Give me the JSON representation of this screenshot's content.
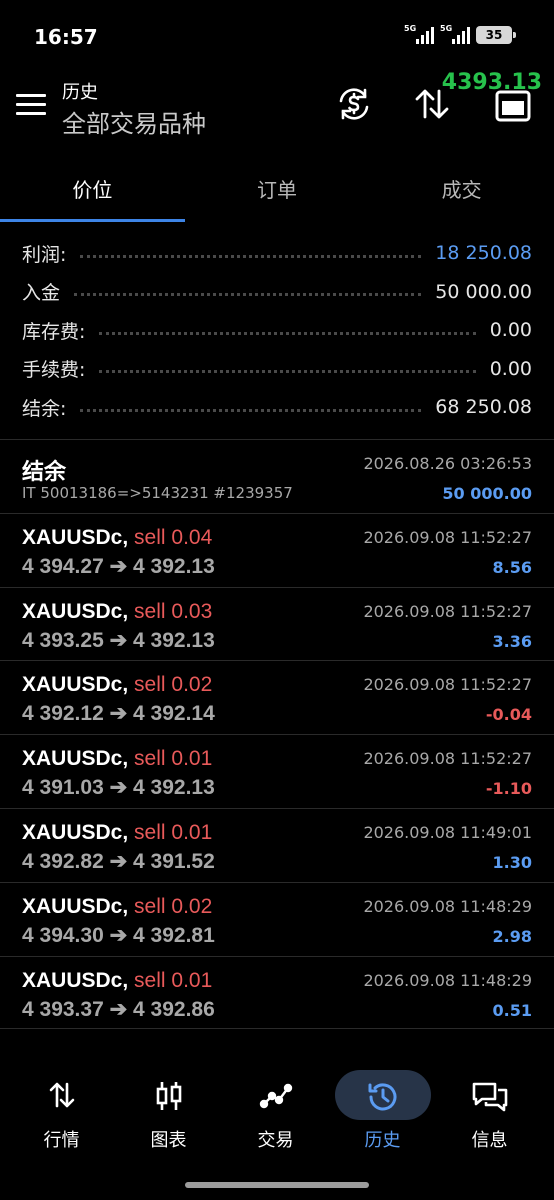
{
  "status": {
    "time": "16:57",
    "sim1": "5G",
    "sim2": "5G",
    "battery": "35"
  },
  "header": {
    "title": "历史",
    "subtitle": "全部交易品种",
    "floating_price": "4393.13",
    "icons": [
      "menu-icon",
      "currency-exchange-icon",
      "sort-icon",
      "window-icon"
    ]
  },
  "tabs": [
    {
      "label": "价位",
      "active": true
    },
    {
      "label": "订单",
      "active": false
    },
    {
      "label": "成交",
      "active": false
    }
  ],
  "summary": [
    {
      "label": "利润:",
      "value": "18 250.08",
      "color": "#5b9cf2"
    },
    {
      "label": "入金",
      "value": "50 000.00"
    },
    {
      "label": "库存费:",
      "value": "0.00"
    },
    {
      "label": "手续费:",
      "value": "0.00"
    },
    {
      "label": "结余:",
      "value": "68 250.08"
    }
  ],
  "balance": {
    "title": "结余",
    "comment": "IT 50013186=>5143231 #1239357",
    "datetime": "2026.08.26 03:26:53",
    "amount": "50 000.00"
  },
  "deals": [
    {
      "symbol": "XAUUSDc,",
      "side": "sell 0.04",
      "open": "4 394.27",
      "close": "4 392.13",
      "datetime": "2026.09.08 11:52:27",
      "profit": "8.56",
      "sign": "pos"
    },
    {
      "symbol": "XAUUSDc,",
      "side": "sell 0.03",
      "open": "4 393.25",
      "close": "4 392.13",
      "datetime": "2026.09.08 11:52:27",
      "profit": "3.36",
      "sign": "pos"
    },
    {
      "symbol": "XAUUSDc,",
      "side": "sell 0.02",
      "open": "4 392.12",
      "close": "4 392.14",
      "datetime": "2026.09.08 11:52:27",
      "profit": "-0.04",
      "sign": "neg"
    },
    {
      "symbol": "XAUUSDc,",
      "side": "sell 0.01",
      "open": "4 391.03",
      "close": "4 392.13",
      "datetime": "2026.09.08 11:52:27",
      "profit": "-1.10",
      "sign": "neg"
    },
    {
      "symbol": "XAUUSDc,",
      "side": "sell 0.01",
      "open": "4 392.82",
      "close": "4 391.52",
      "datetime": "2026.09.08 11:49:01",
      "profit": "1.30",
      "sign": "pos"
    },
    {
      "symbol": "XAUUSDc,",
      "side": "sell 0.02",
      "open": "4 394.30",
      "close": "4 392.81",
      "datetime": "2026.09.08 11:48:29",
      "profit": "2.98",
      "sign": "pos"
    },
    {
      "symbol": "XAUUSDc,",
      "side": "sell 0.01",
      "open": "4 393.37",
      "close": "4 392.86",
      "datetime": "2026.09.08 11:48:29",
      "profit": "0.51",
      "sign": "pos"
    }
  ],
  "arrow": "➔",
  "bottom_nav": [
    {
      "label": "行情",
      "icon": "quotes-icon",
      "active": false
    },
    {
      "label": "图表",
      "icon": "candlestick-icon",
      "active": false
    },
    {
      "label": "交易",
      "icon": "trade-icon",
      "active": false
    },
    {
      "label": "历史",
      "icon": "history-icon",
      "active": true
    },
    {
      "label": "信息",
      "icon": "messages-icon",
      "active": false
    }
  ]
}
